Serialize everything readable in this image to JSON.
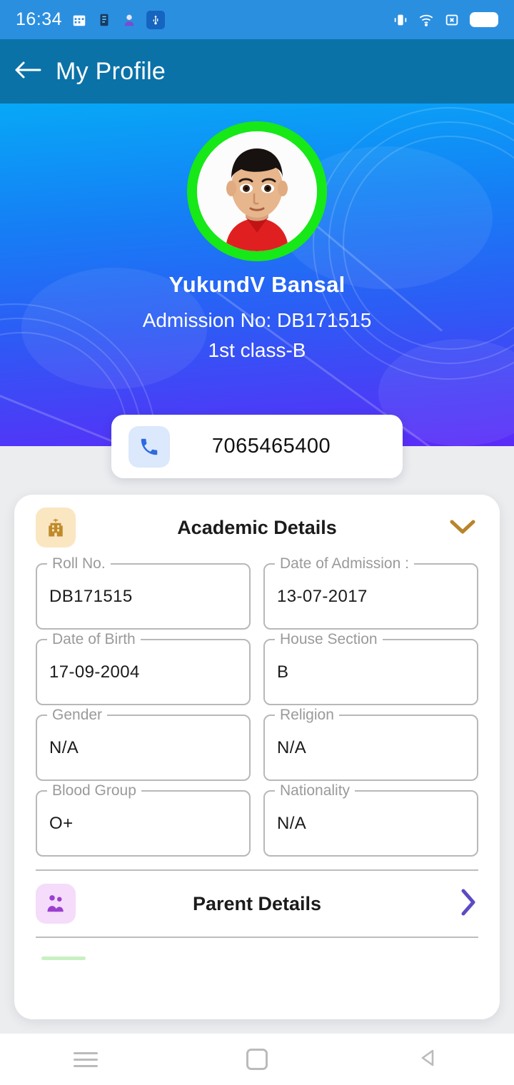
{
  "status_bar": {
    "time": "16:34",
    "left_icons": [
      "calendar-icon",
      "note-icon",
      "app-icon",
      "usb-icon"
    ],
    "right_icons": [
      "vibrate-icon",
      "wifi-icon",
      "sim-icon",
      "battery-icon"
    ]
  },
  "app_bar": {
    "back_icon": "arrow-left-icon",
    "title": "My Profile"
  },
  "hero": {
    "avatar_alt": "student-photo",
    "avatar_ring_color": "#17E817",
    "name": "YukundV Bansal",
    "admission_line": "Admission No: DB171515",
    "class_line": "1st class-B",
    "gradient_from": "#07A8F7",
    "gradient_to": "#5B2BF8"
  },
  "phone_card": {
    "icon": "phone-icon",
    "number": "7065465400"
  },
  "academic_section": {
    "icon": "school-building-icon",
    "title": "Academic Details",
    "expand_icon": "chevron-down-icon",
    "expand_icon_color": "#B9842A",
    "expanded": true,
    "fields": [
      {
        "label": "Roll No.",
        "value": "DB171515"
      },
      {
        "label": "Date of Admission :",
        "value": "13-07-2017"
      },
      {
        "label": "Date of Birth",
        "value": "17-09-2004"
      },
      {
        "label": "House Section",
        "value": "B"
      },
      {
        "label": "Gender",
        "value": "N/A"
      },
      {
        "label": "Religion",
        "value": "N/A"
      },
      {
        "label": "Blood Group",
        "value": "O+"
      },
      {
        "label": "Nationality",
        "value": "N/A"
      }
    ]
  },
  "parent_section": {
    "icon": "family-icon",
    "title": "Parent Details",
    "expand_icon": "chevron-right-icon",
    "expand_icon_color": "#5B4BC4",
    "expanded": false
  },
  "nav_bar": {
    "recents": "menu-icon",
    "home": "home-square-icon",
    "back": "back-triangle-icon"
  }
}
